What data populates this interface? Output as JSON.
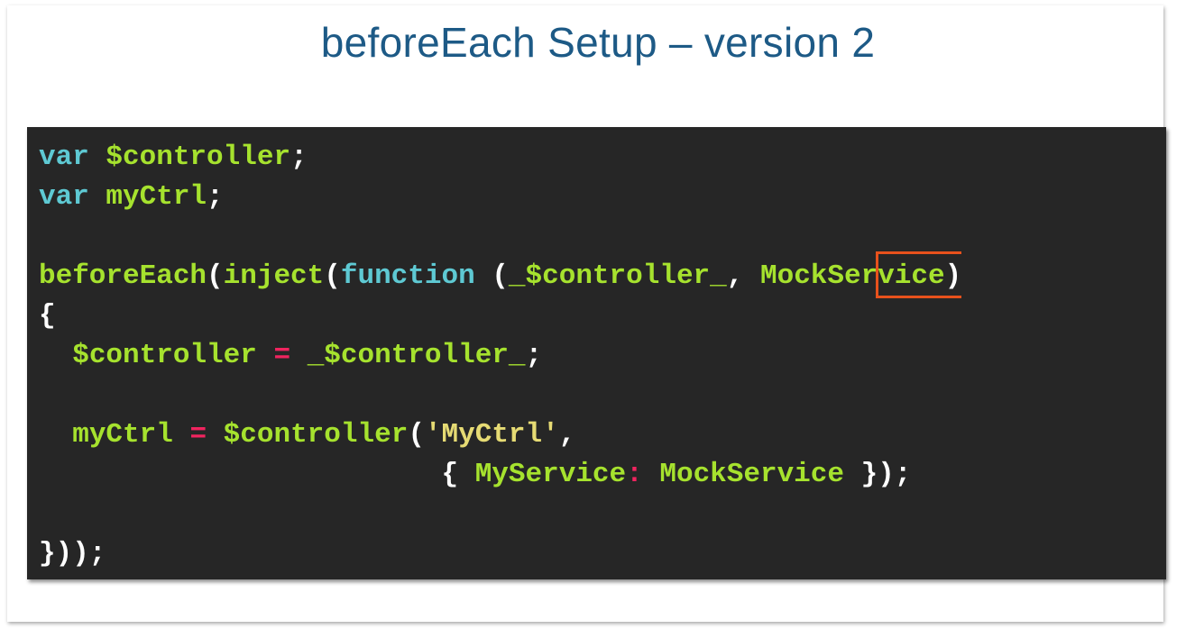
{
  "slide": {
    "title": "beforeEach Setup – version 2"
  },
  "code": {
    "line1": {
      "kw": "var",
      "id": "$controller",
      "end": ";"
    },
    "line2": {
      "kw": "var",
      "id": "myCtrl",
      "end": ";"
    },
    "line3": {
      "fn": "beforeEach",
      "p1": "(",
      "inject": "inject",
      "p2": "(",
      "kw": "function",
      "p3": " (",
      "arg1": "_$controller_",
      "comma": ", ",
      "arg2": "MockService",
      "p4": ")"
    },
    "line4": {
      "brace": "{"
    },
    "line5": {
      "lhs": "$controller",
      "op": "=",
      "rhs": "_$controller_",
      "end": ";"
    },
    "line6": {
      "lhs": "myCtrl",
      "op": "=",
      "call": "$controller",
      "p1": "(",
      "str": "'MyCtrl'",
      "end": ","
    },
    "line7": {
      "open": "{ ",
      "key": "MyService",
      "colon": ":",
      "val": "MockService",
      "close": " });"
    },
    "line8": {
      "close": "}));"
    }
  },
  "colors": {
    "title": "#1d5a86",
    "code_background": "#262626",
    "keyword": "#5ec9d3",
    "identifier": "#a6e22e",
    "operator": "#f0245f",
    "string": "#e6db74",
    "highlight_box": "#e7511c"
  }
}
